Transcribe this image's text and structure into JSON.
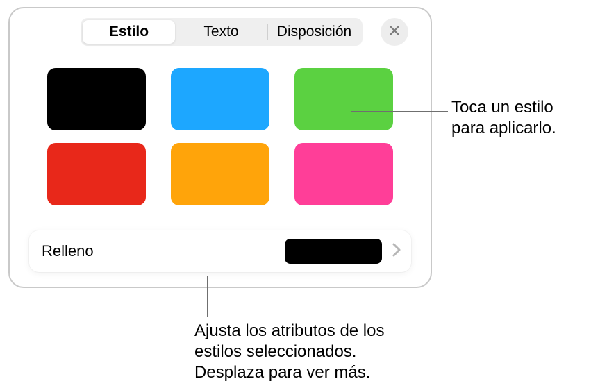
{
  "tabs": {
    "items": [
      {
        "label": "Estilo",
        "active": true
      },
      {
        "label": "Texto",
        "active": false
      },
      {
        "label": "Disposición",
        "active": false
      }
    ]
  },
  "close_icon": "close-icon",
  "swatches": [
    {
      "color": "#000000"
    },
    {
      "color": "#1da7ff"
    },
    {
      "color": "#5bd141"
    },
    {
      "color": "#e8281a"
    },
    {
      "color": "#ffa40a"
    },
    {
      "color": "#ff3e98"
    }
  ],
  "fill": {
    "label": "Relleno",
    "swatch_color": "#000000"
  },
  "callouts": {
    "apply": "Toca un estilo para aplicarlo.",
    "adjust": "Ajusta los atributos de los estilos seleccionados. Desplaza para ver más."
  }
}
